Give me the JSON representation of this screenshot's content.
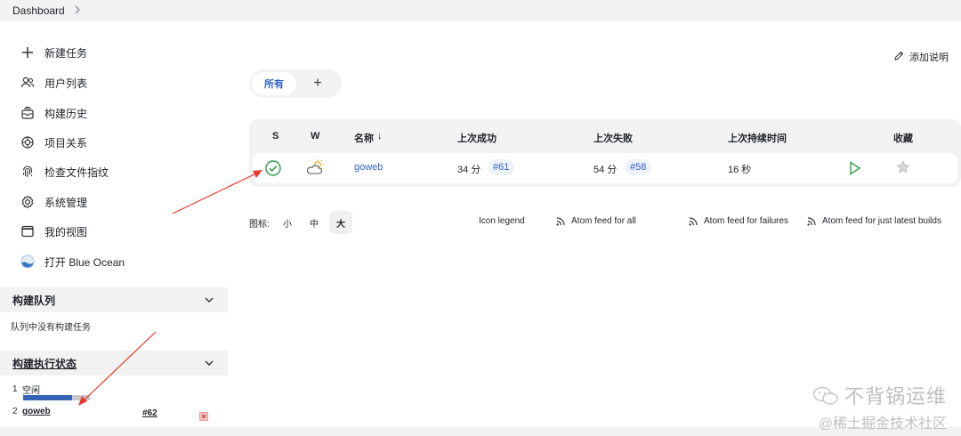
{
  "breadcrumb": {
    "dashboard": "Dashboard",
    "separator": ">"
  },
  "sidebar": {
    "items": [
      {
        "label": "新建任务",
        "icon": "plus-icon"
      },
      {
        "label": "用户列表",
        "icon": "users-icon"
      },
      {
        "label": "构建历史",
        "icon": "history-icon"
      },
      {
        "label": "项目关系",
        "icon": "relation-icon"
      },
      {
        "label": "检查文件指纹",
        "icon": "fingerprint-icon"
      },
      {
        "label": "系统管理",
        "icon": "gear-icon"
      },
      {
        "label": "我的视图",
        "icon": "window-icon"
      },
      {
        "label": "打开 Blue Ocean",
        "icon": "blue-ocean-icon"
      }
    ],
    "build_queue": {
      "title": "构建队列",
      "empty_text": "队列中没有构建任务"
    },
    "executors": {
      "title": "构建执行状态",
      "rows": [
        {
          "num": "1",
          "status": "空闲"
        },
        {
          "num": "2",
          "job": "goweb",
          "build": "#62",
          "progress": 0.73
        }
      ]
    }
  },
  "main": {
    "add_description": "添加说明",
    "tabs": {
      "all": "所有",
      "add": "+"
    },
    "table": {
      "headers": {
        "s": "S",
        "w": "W",
        "name": "名称",
        "sort_arrow": "↓",
        "last_success": "上次成功",
        "last_failure": "上次失败",
        "last_duration": "上次持续时间",
        "favorite": "收藏"
      },
      "rows": [
        {
          "name": "goweb",
          "success_time": "34 分",
          "success_build": "#61",
          "failure_time": "54 分",
          "failure_build": "#58",
          "duration": "16 秒"
        }
      ]
    },
    "legend": {
      "icon_label": "图标:",
      "sizes": [
        "小",
        "中",
        "大"
      ],
      "active_size": "大",
      "icon_legend": "Icon legend",
      "feeds": [
        "Atom feed for all",
        "Atom feed for failures",
        "Atom feed for just latest builds"
      ]
    }
  },
  "watermark": {
    "line1": "不背锅运维",
    "line2": "@稀土掘金技术社区"
  },
  "colors": {
    "accent": "#2e62c5",
    "success": "#2e9e47",
    "annotation": "#e8372c"
  }
}
